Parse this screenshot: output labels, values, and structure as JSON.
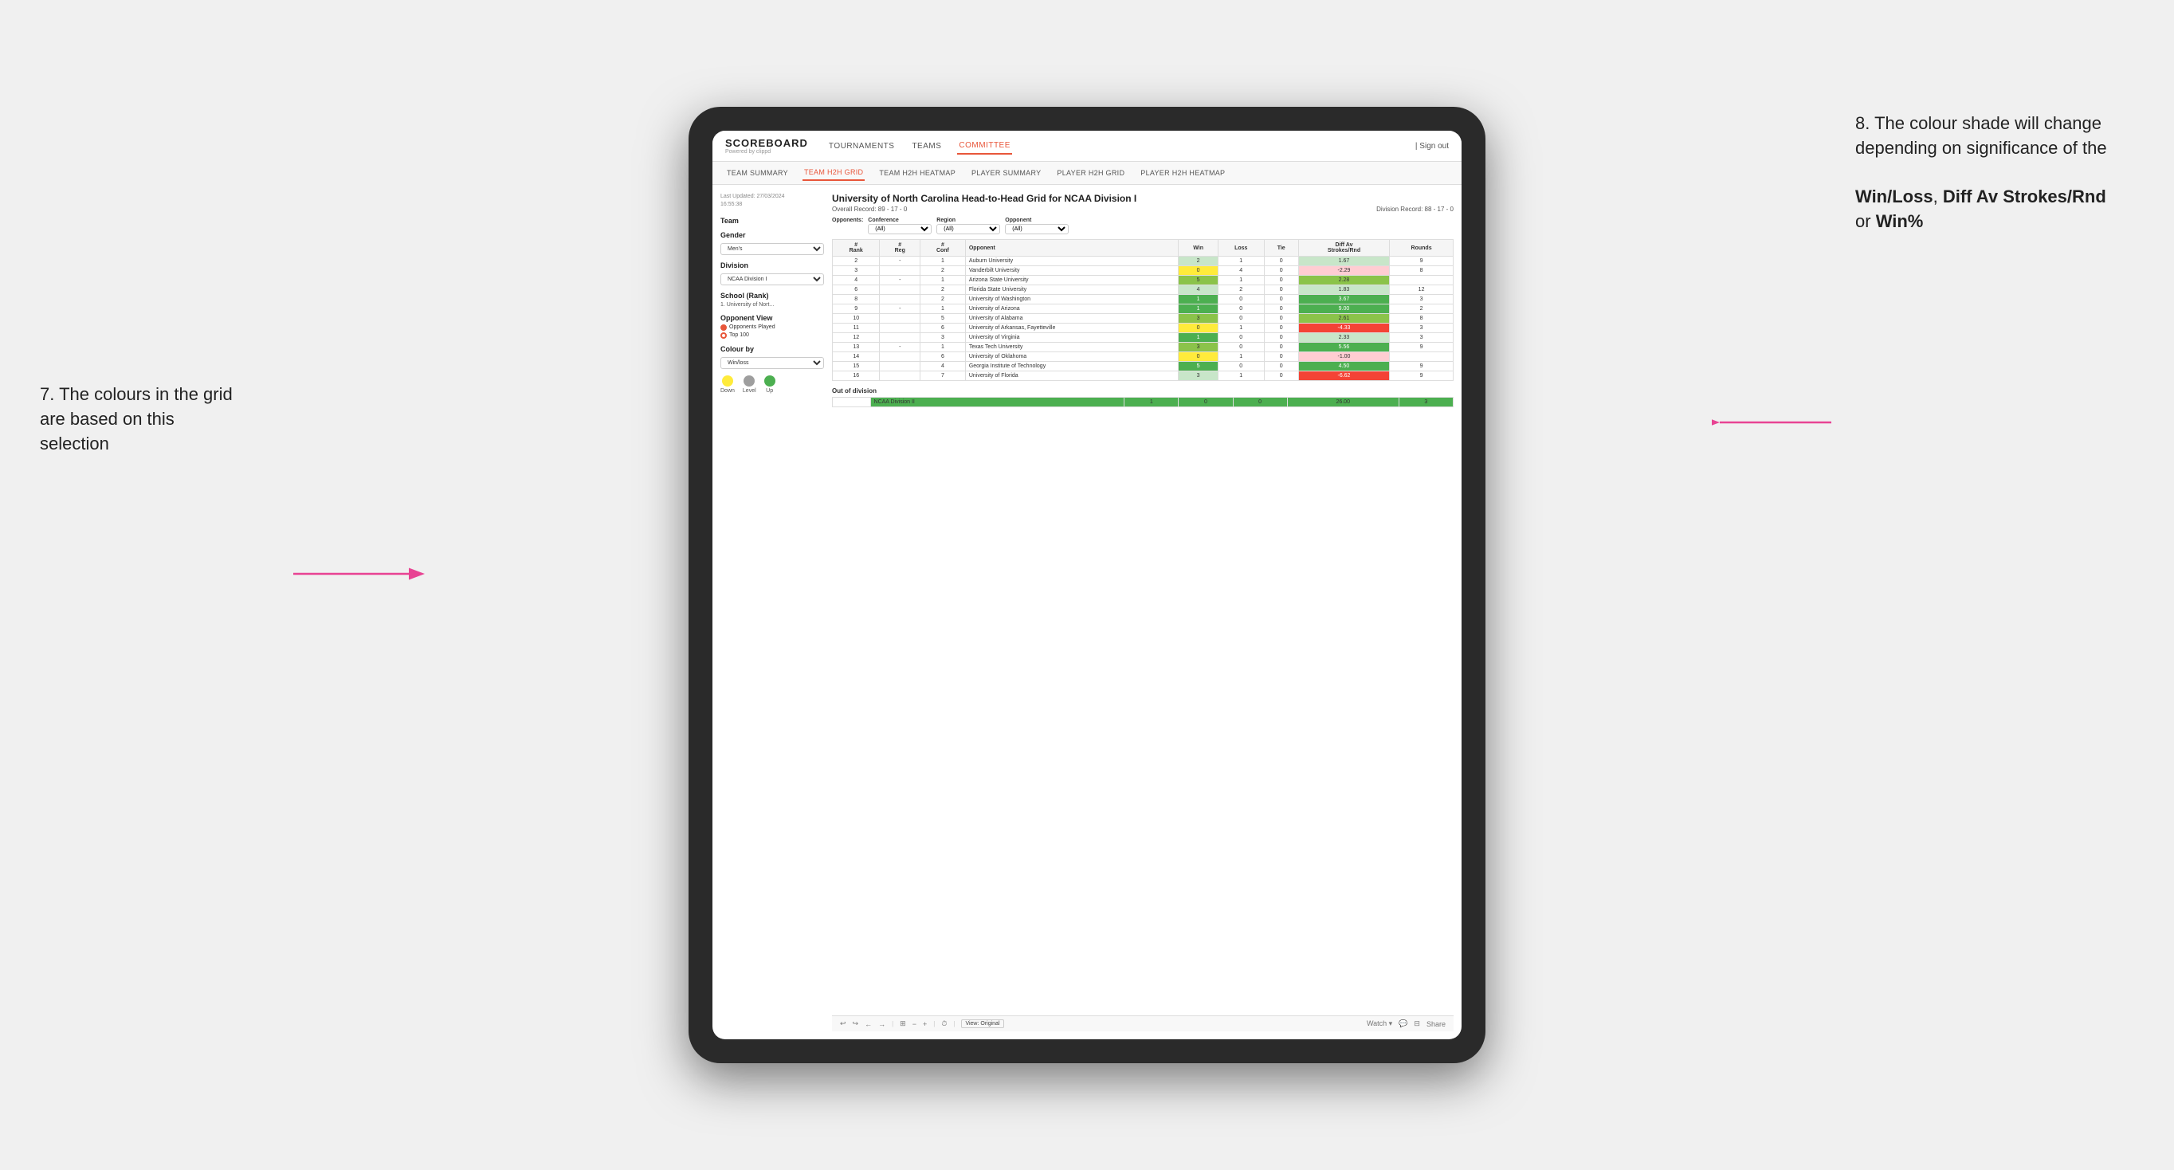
{
  "annotations": {
    "left_title": "7. The colours in the grid are based on this selection",
    "right_title": "8. The colour shade will change depending on significance of the",
    "right_bold1": "Win/Loss",
    "right_bold2": "Diff Av Strokes/Rnd",
    "right_bold3": "Win%"
  },
  "nav": {
    "logo": "SCOREBOARD",
    "logo_sub": "Powered by clippd",
    "items": [
      "TOURNAMENTS",
      "TEAMS",
      "COMMITTEE"
    ],
    "active": "COMMITTEE",
    "sign_out": "Sign out"
  },
  "secondary_nav": {
    "items": [
      "TEAM SUMMARY",
      "TEAM H2H GRID",
      "TEAM H2H HEATMAP",
      "PLAYER SUMMARY",
      "PLAYER H2H GRID",
      "PLAYER H2H HEATMAP"
    ],
    "active": "TEAM H2H GRID"
  },
  "left_panel": {
    "last_updated_label": "Last Updated: 27/03/2024",
    "last_updated_time": "16:55:38",
    "team_label": "Team",
    "gender_label": "Gender",
    "gender_value": "Men's",
    "division_label": "Division",
    "division_value": "NCAA Division I",
    "school_label": "School (Rank)",
    "school_value": "1. University of Nort...",
    "opponent_view_label": "Opponent View",
    "opponents_played": "Opponents Played",
    "top_100": "Top 100",
    "colour_by_label": "Colour by",
    "colour_by_value": "Win/loss",
    "legend_down": "Down",
    "legend_level": "Level",
    "legend_up": "Up"
  },
  "grid": {
    "title": "University of North Carolina Head-to-Head Grid for NCAA Division I",
    "overall_record": "Overall Record: 89 - 17 - 0",
    "division_record": "Division Record: 88 - 17 - 0",
    "filters": {
      "conference_label": "Conference",
      "conference_value": "(All)",
      "region_label": "Region",
      "region_value": "(All)",
      "opponent_label": "Opponent",
      "opponent_value": "(All)",
      "opponents_label": "Opponents:"
    },
    "columns": [
      "#\nRank",
      "#\nReg",
      "#\nConf",
      "Opponent",
      "Win",
      "Loss",
      "Tie",
      "Diff Av\nStrokes/Rnd",
      "Rounds"
    ],
    "rows": [
      {
        "rank": "2",
        "reg": "-",
        "conf": "1",
        "opponent": "Auburn University",
        "win": "2",
        "loss": "1",
        "tie": "0",
        "diff": "1.67",
        "rounds": "9",
        "win_color": "green_light",
        "diff_color": "green_light"
      },
      {
        "rank": "3",
        "reg": "",
        "conf": "2",
        "opponent": "Vanderbilt University",
        "win": "0",
        "loss": "4",
        "tie": "0",
        "diff": "-2.29",
        "rounds": "8",
        "win_color": "yellow",
        "diff_color": "red_light"
      },
      {
        "rank": "4",
        "reg": "-",
        "conf": "1",
        "opponent": "Arizona State University",
        "win": "5",
        "loss": "1",
        "tie": "0",
        "diff": "2.28",
        "rounds": "",
        "win_color": "green_med",
        "diff_color": "green_med"
      },
      {
        "rank": "6",
        "reg": "",
        "conf": "2",
        "opponent": "Florida State University",
        "win": "4",
        "loss": "2",
        "tie": "0",
        "diff": "1.83",
        "rounds": "12",
        "win_color": "green_light",
        "diff_color": "green_light"
      },
      {
        "rank": "8",
        "reg": "",
        "conf": "2",
        "opponent": "University of Washington",
        "win": "1",
        "loss": "0",
        "tie": "0",
        "diff": "3.67",
        "rounds": "3",
        "win_color": "green_dark",
        "diff_color": "green_dark"
      },
      {
        "rank": "9",
        "reg": "-",
        "conf": "1",
        "opponent": "University of Arizona",
        "win": "1",
        "loss": "0",
        "tie": "0",
        "diff": "9.00",
        "rounds": "2",
        "win_color": "green_dark",
        "diff_color": "green_dark"
      },
      {
        "rank": "10",
        "reg": "",
        "conf": "5",
        "opponent": "University of Alabama",
        "win": "3",
        "loss": "0",
        "tie": "0",
        "diff": "2.61",
        "rounds": "8",
        "win_color": "green_med",
        "diff_color": "green_med"
      },
      {
        "rank": "11",
        "reg": "",
        "conf": "6",
        "opponent": "University of Arkansas, Fayetteville",
        "win": "0",
        "loss": "1",
        "tie": "0",
        "diff": "-4.33",
        "rounds": "3",
        "win_color": "yellow",
        "diff_color": "red"
      },
      {
        "rank": "12",
        "reg": "",
        "conf": "3",
        "opponent": "University of Virginia",
        "win": "1",
        "loss": "0",
        "tie": "0",
        "diff": "2.33",
        "rounds": "3",
        "win_color": "green_dark",
        "diff_color": "green_light"
      },
      {
        "rank": "13",
        "reg": "-",
        "conf": "1",
        "opponent": "Texas Tech University",
        "win": "3",
        "loss": "0",
        "tie": "0",
        "diff": "5.56",
        "rounds": "9",
        "win_color": "green_med",
        "diff_color": "green_dark"
      },
      {
        "rank": "14",
        "reg": "",
        "conf": "6",
        "opponent": "University of Oklahoma",
        "win": "0",
        "loss": "1",
        "tie": "0",
        "diff": "-1.00",
        "rounds": "",
        "win_color": "yellow",
        "diff_color": "red_light"
      },
      {
        "rank": "15",
        "reg": "",
        "conf": "4",
        "opponent": "Georgia Institute of Technology",
        "win": "5",
        "loss": "0",
        "tie": "0",
        "diff": "4.50",
        "rounds": "9",
        "win_color": "green_dark",
        "diff_color": "green_dark"
      },
      {
        "rank": "16",
        "reg": "",
        "conf": "7",
        "opponent": "University of Florida",
        "win": "3",
        "loss": "1",
        "tie": "0",
        "diff": "-6.62",
        "rounds": "9",
        "win_color": "green_light",
        "diff_color": "red"
      }
    ],
    "out_of_division_label": "Out of division",
    "out_of_division_rows": [
      {
        "name": "NCAA Division II",
        "win": "1",
        "loss": "0",
        "tie": "0",
        "diff": "26.00",
        "rounds": "3",
        "bg": "green_dark"
      }
    ]
  },
  "toolbar": {
    "view_original": "View: Original",
    "watch": "Watch ▾",
    "share": "Share"
  }
}
